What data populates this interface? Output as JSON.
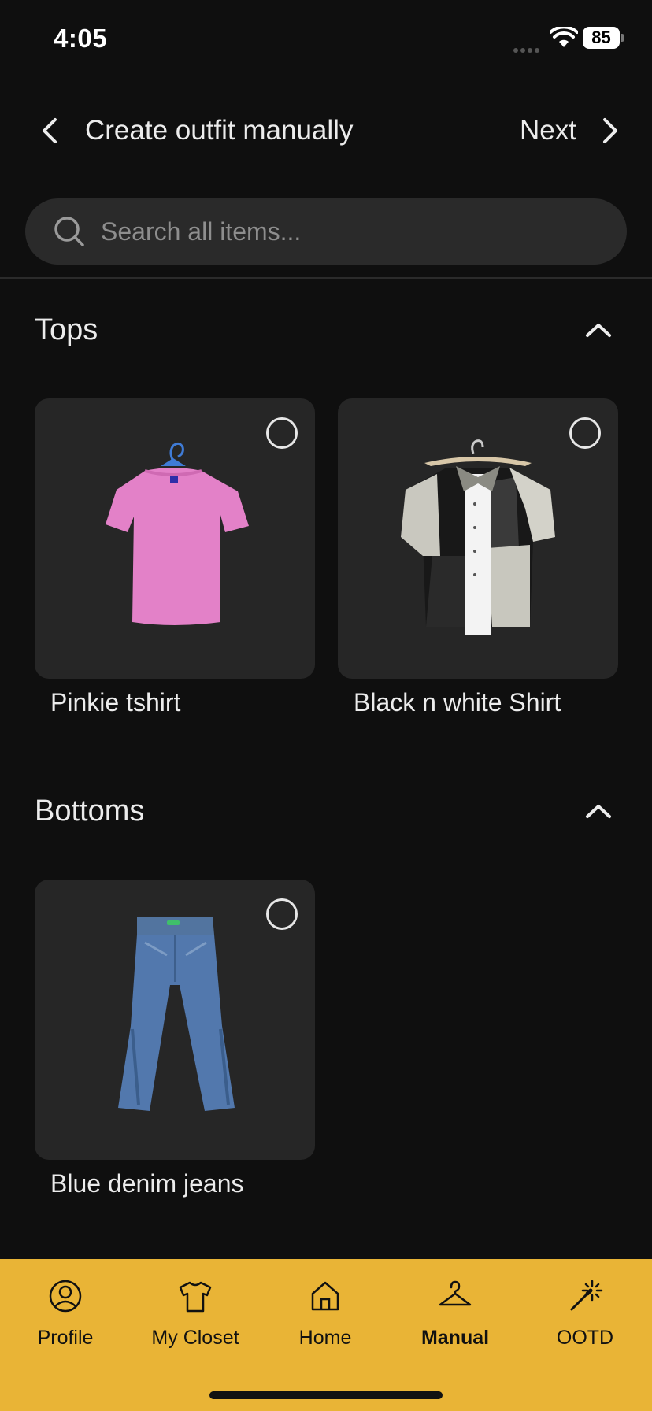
{
  "status_bar": {
    "time": "4:05",
    "battery": "85"
  },
  "header": {
    "title": "Create outfit manually",
    "next_label": "Next"
  },
  "search": {
    "placeholder": "Search all items..."
  },
  "sections": [
    {
      "title": "Tops",
      "items": [
        {
          "label": "Pinkie tshirt",
          "selected": false,
          "color": "#e381c8"
        },
        {
          "label": "Black n white Shirt",
          "selected": false,
          "color": "#1b1b1b"
        }
      ]
    },
    {
      "title": "Bottoms",
      "items": [
        {
          "label": "Blue denim jeans",
          "selected": false,
          "color": "#4f75a9"
        }
      ]
    }
  ],
  "nav": {
    "items": [
      {
        "label": "Profile",
        "icon": "profile-icon"
      },
      {
        "label": "My Closet",
        "icon": "tshirt-icon"
      },
      {
        "label": "Home",
        "icon": "home-icon"
      },
      {
        "label": "Manual",
        "icon": "hanger-icon",
        "active": true
      },
      {
        "label": "OOTD",
        "icon": "magic-wand-icon"
      }
    ],
    "background": "#e9b436"
  },
  "colors": {
    "background": "#0f0f0f",
    "card": "#262626",
    "search_bg": "#2a2a2a",
    "accent": "#e9b436"
  }
}
